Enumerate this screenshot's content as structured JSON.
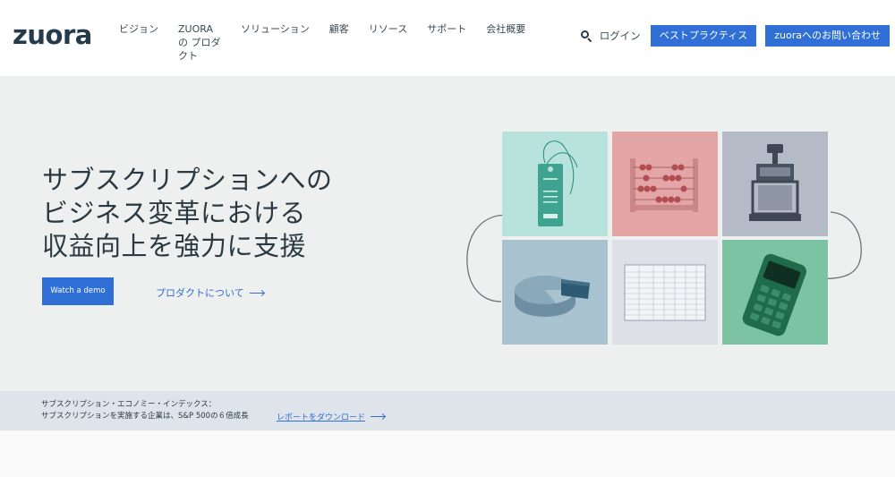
{
  "header": {
    "logo": "zuora",
    "nav": [
      {
        "label": "ビジョン"
      },
      {
        "label": "ZUORAの プロダクト"
      },
      {
        "label": "ソリューション"
      },
      {
        "label": "顧客"
      },
      {
        "label": "リソース"
      },
      {
        "label": "サポート"
      },
      {
        "label": "会社概要"
      }
    ],
    "search_icon": "search-icon",
    "login": "ログイン",
    "best_practices_button": "ベストプラクティス",
    "contact_button": "zuoraへのお問い合わせ"
  },
  "hero": {
    "title_lines": [
      "サブスクリプションへの",
      "ビジネス変革における",
      "収益向上を強力に支援"
    ],
    "demo_button": "Watch a demo",
    "product_link": "プロダクトについて"
  },
  "tiles": [
    {
      "name": "price-tag",
      "color": "#b7e3dc"
    },
    {
      "name": "abacus",
      "color": "#e3a5a6"
    },
    {
      "name": "stamp",
      "color": "#b4bac6"
    },
    {
      "name": "pie-chart",
      "color": "#a9c2d0"
    },
    {
      "name": "ledger",
      "color": "#dfe0e7"
    },
    {
      "name": "card-terminal",
      "color": "#7cc3a4"
    }
  ],
  "banner": {
    "line1": "サブスクリプション・エコノミー・インデックス：",
    "line2": "サブスクリプションを実施する企業は、S&P 500の６倍成長",
    "link": "レポートをダウンロード"
  },
  "colors": {
    "accent": "#2f6fd6",
    "hero_bg": "#eef0f0",
    "banner_bg": "#dfe3ea",
    "logo": "#253b4b"
  }
}
